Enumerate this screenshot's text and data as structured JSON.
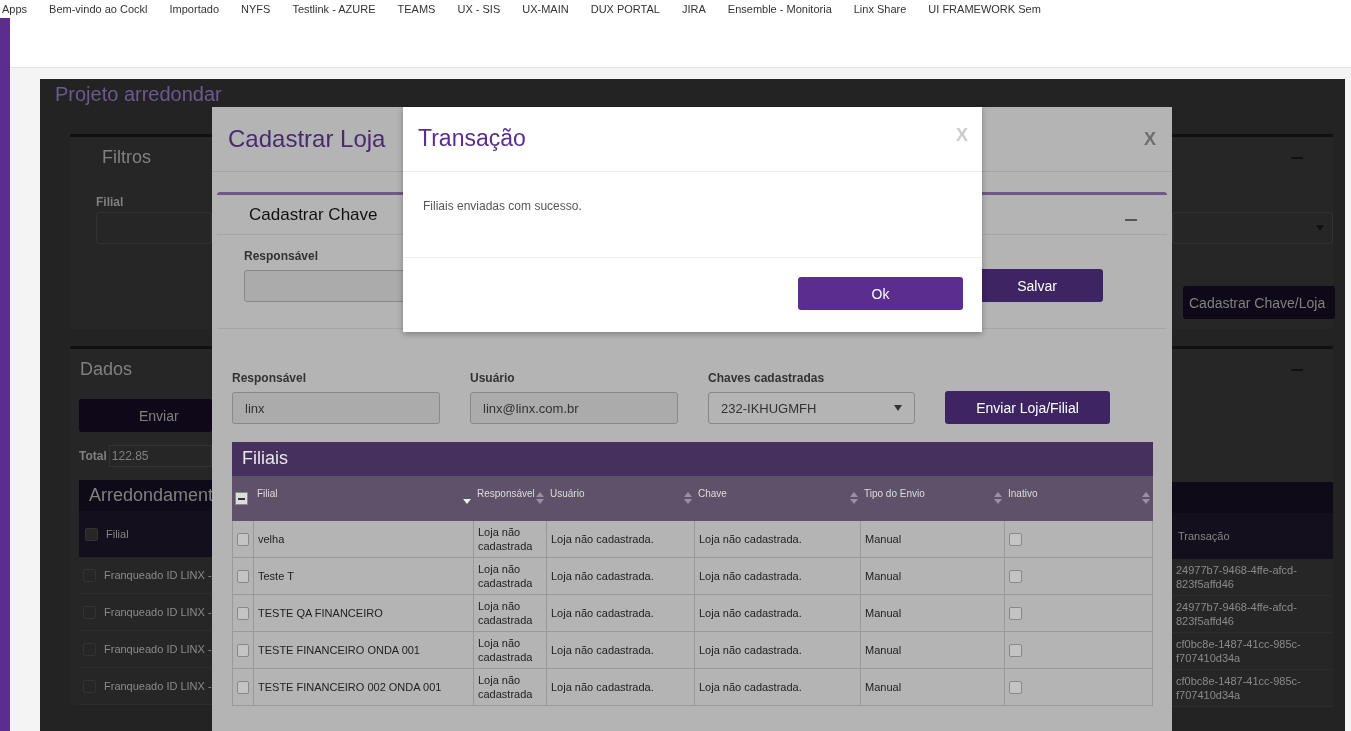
{
  "bookmarks": [
    "Apps",
    "Bem-vindo ao Cockl",
    "Importado",
    "NYFS",
    "Testlink - AZURE",
    "TEAMS",
    "UX - SIS",
    "UX-MAIN",
    "DUX PORTAL",
    "JIRA",
    "Ensemble - Monitoria",
    "Linx Share",
    "UI FRAMEWORK Sem"
  ],
  "page": {
    "title": "Projeto arredondar",
    "filters": {
      "title": "Filtros",
      "filial_label": "Filial"
    },
    "register_button": "Cadastrar Chave/Loja",
    "data": {
      "title": "Dados",
      "send_button": "Enviar",
      "total_label": "Total",
      "total_value": "122.85",
      "table": {
        "title": "Arredondament",
        "all_selected": false,
        "columns": [
          "Filial",
          "Transação"
        ],
        "rows": [
          {
            "selected": false,
            "filial": "Franqueado ID LINX -",
            "transaction": [
              "24977b7-9468-4ffe-afcd-",
              "823f5affd46"
            ]
          },
          {
            "selected": false,
            "filial": "Franqueado ID LINX -",
            "transaction": [
              "24977b7-9468-4ffe-afcd-",
              "823f5affd46"
            ]
          },
          {
            "selected": false,
            "filial": "Franqueado ID LINX -",
            "transaction": [
              "cf0bc8e-1487-41cc-985c-",
              "f707410d34a"
            ]
          },
          {
            "selected": false,
            "filial": "Franqueado ID LINX -",
            "transaction": [
              "cf0bc8e-1487-41cc-985c-",
              "f707410d34a"
            ]
          }
        ]
      }
    }
  },
  "store_modal": {
    "title": "Cadastrar Loja",
    "close": "X",
    "key_panel": {
      "title": "Cadastrar Chave",
      "responsavel_label": "Responsável",
      "save_button": "Salvar"
    },
    "form": {
      "responsavel_label": "Responsável",
      "responsavel_value": "linx",
      "usuario_label": "Usuário",
      "usuario_value": "linx@linx.com.br",
      "keys_label": "Chaves cadastradas",
      "keys_value": "232-IKHUGMFH",
      "send_button": "Enviar Loja/Filial"
    },
    "table": {
      "title": "Filiais",
      "select_all_indeterminate": true,
      "columns": [
        {
          "label": "Filial",
          "sorted": true
        },
        {
          "label": "Responsável",
          "sorted": false
        },
        {
          "label": "Usuário",
          "sorted": false
        },
        {
          "label": "Chave",
          "sorted": false
        },
        {
          "label": "Tipo do Envio",
          "sorted": false
        },
        {
          "label": "Inativo",
          "sorted": false
        }
      ],
      "rows": [
        {
          "selected": false,
          "filial": "velha",
          "responsavel": "Loja não cadastrada",
          "usuario": "Loja não cadastrada.",
          "chave": "Loja não cadastrada.",
          "tipo": "Manual",
          "inativo": false
        },
        {
          "selected": false,
          "filial": "Teste T",
          "responsavel": "Loja não cadastrada",
          "usuario": "Loja não cadastrada.",
          "chave": "Loja não cadastrada.",
          "tipo": "Manual",
          "inativo": false
        },
        {
          "selected": false,
          "filial": "TESTE QA FINANCEIRO",
          "responsavel": "Loja não cadastrada",
          "usuario": "Loja não cadastrada.",
          "chave": "Loja não cadastrada.",
          "tipo": "Manual",
          "inativo": false
        },
        {
          "selected": false,
          "filial": "TESTE FINANCEIRO ONDA 001",
          "responsavel": "Loja não cadastrada",
          "usuario": "Loja não cadastrada.",
          "chave": "Loja não cadastrada.",
          "tipo": "Manual",
          "inativo": false
        },
        {
          "selected": false,
          "filial": "TESTE FINANCEIRO 002 ONDA 001",
          "responsavel": "Loja não cadastrada",
          "usuario": "Loja não cadastrada.",
          "chave": "Loja não cadastrada.",
          "tipo": "Manual",
          "inativo": false
        }
      ]
    }
  },
  "dialog": {
    "title": "Transação",
    "close": "X",
    "message": "Filiais enviadas com sucesso.",
    "ok_button": "Ok"
  }
}
